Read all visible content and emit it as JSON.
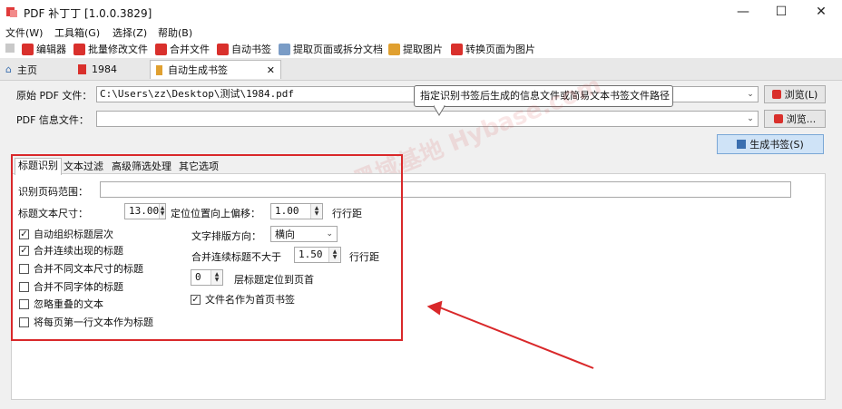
{
  "window": {
    "title": "PDF 补丁丁 [1.0.0.3829]",
    "minimize": "—",
    "maximize": "☐",
    "close": "✕"
  },
  "menu": [
    "文件(W)",
    "工具箱(G)",
    "选择(Z)",
    "帮助(B)"
  ],
  "toolbar": [
    {
      "label": "编辑器",
      "color": "#d9302c"
    },
    {
      "label": "批量修改文件",
      "color": "#d9302c"
    },
    {
      "label": "合并文件",
      "color": "#d9302c"
    },
    {
      "label": "自动书签",
      "color": "#d9302c"
    },
    {
      "label": "提取页面或拆分文档",
      "color": "#7a9cc6"
    },
    {
      "label": "提取图片",
      "color": "#e0a030"
    },
    {
      "label": "转换页面为图片",
      "color": "#d9302c"
    }
  ],
  "doc_tabs": [
    {
      "label": "主页",
      "icon": "home-icon"
    },
    {
      "label": "1984",
      "icon": "pdf-file-icon"
    },
    {
      "label": "自动生成书签",
      "icon": "bookmark-icon"
    }
  ],
  "tab_close": "✕",
  "form": {
    "source_label": "原始 PDF 文件：",
    "source_value": "C:\\Users\\zz\\Desktop\\测试\\1984.pdf",
    "info_label": "PDF 信息文件：",
    "info_value": "",
    "browse1": "浏览(L)",
    "browse2": "浏览...",
    "generate": "生成书签(S)",
    "tooltip": "指定识别书签后生成的信息文件或简易文本书签文件路径"
  },
  "watermark": "亿网收藏·黑域基地  Hybase.com",
  "inner_tabs": [
    "标题识别",
    "文本过滤",
    "高级筛选处理",
    "其它选项"
  ],
  "options": {
    "page_range_label": "识别页码范围：",
    "page_range_value": "",
    "title_size_label": "标题文本尺寸：",
    "title_size_value": "13.00",
    "offset_label": "定位位置向上偏移：",
    "offset_value": "1.00",
    "offset_unit": "行行距",
    "direction_label": "文字排版方向：",
    "direction_value": "横向",
    "merge_limit_label": "合并连续标题不大于",
    "merge_limit_value": "1.50",
    "merge_limit_unit": "行行距",
    "level_value": "0",
    "level_label": "层标题定位到页首",
    "checkboxes_left": [
      {
        "label": "自动组织标题层次",
        "checked": true
      },
      {
        "label": "合并连续出现的标题",
        "checked": true
      },
      {
        "label": "合并不同文本尺寸的标题",
        "checked": false
      },
      {
        "label": "合并不同字体的标题",
        "checked": false
      },
      {
        "label": "忽略重叠的文本",
        "checked": false
      },
      {
        "label": "将每页第一行文本作为标题",
        "checked": false
      }
    ],
    "filename_checkbox": {
      "label": "文件名作为首页书签",
      "checked": true
    }
  },
  "colors": {
    "highlight_box": "#d9282a",
    "arrow": "#d9282a"
  }
}
